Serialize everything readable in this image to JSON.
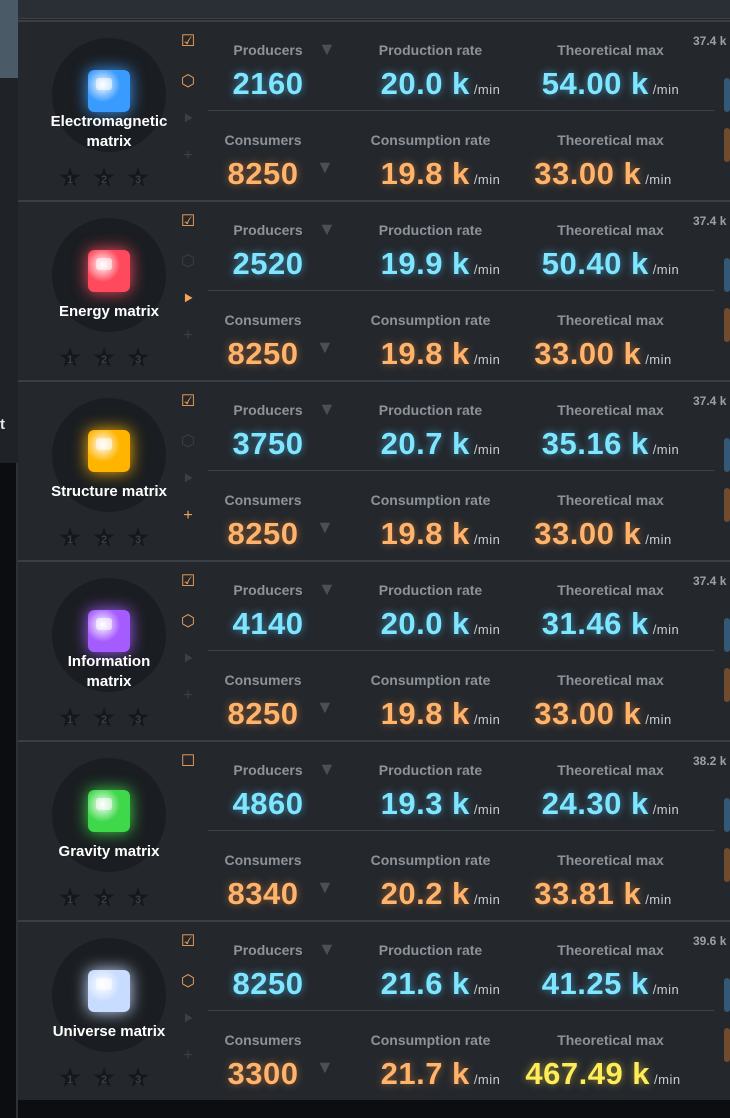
{
  "side_fragment": "t",
  "labels": {
    "producers": "Producers",
    "production_rate": "Production rate",
    "theoretical_max": "Theoretical max",
    "consumers": "Consumers",
    "consumption_rate": "Consumption rate",
    "per_min": "/min"
  },
  "matrices": [
    {
      "name": "Electromagnetic\nmatrix",
      "color": "#3a9bff",
      "producers": "2160",
      "production_rate": "20.0 k",
      "prod_max": "54.00 k",
      "consumers": "8250",
      "consumption_rate": "19.8 k",
      "cons_max": "33.00 k",
      "side_value": "37.4 k",
      "controls": {
        "check": "on",
        "box": "on",
        "play": "off",
        "plus": "off"
      }
    },
    {
      "name": "Energy matrix",
      "color": "#ff4a5e",
      "producers": "2520",
      "production_rate": "19.9 k",
      "prod_max": "50.40 k",
      "consumers": "8250",
      "consumption_rate": "19.8 k",
      "cons_max": "33.00 k",
      "side_value": "37.4 k",
      "controls": {
        "check": "on",
        "box": "off",
        "play": "on",
        "plus": "off"
      }
    },
    {
      "name": "Structure matrix",
      "color": "#ffb400",
      "producers": "3750",
      "production_rate": "20.7 k",
      "prod_max": "35.16 k",
      "consumers": "8250",
      "consumption_rate": "19.8 k",
      "cons_max": "33.00 k",
      "side_value": "37.4 k",
      "controls": {
        "check": "on",
        "box": "off",
        "play": "off",
        "plus": "on"
      }
    },
    {
      "name": "Information\nmatrix",
      "color": "#a55cff",
      "producers": "4140",
      "production_rate": "20.0 k",
      "prod_max": "31.46 k",
      "consumers": "8250",
      "consumption_rate": "19.8 k",
      "cons_max": "33.00 k",
      "side_value": "37.4 k",
      "controls": {
        "check": "on",
        "box": "on",
        "play": "off",
        "plus": "off"
      }
    },
    {
      "name": "Gravity matrix",
      "color": "#3fd84a",
      "producers": "4860",
      "production_rate": "19.3 k",
      "prod_max": "24.30 k",
      "consumers": "8340",
      "consumption_rate": "20.2 k",
      "cons_max": "33.81 k",
      "side_value": "38.2 k",
      "controls": {
        "check": "unchecked",
        "box": "none",
        "play": "none",
        "plus": "none"
      }
    },
    {
      "name": "Universe matrix",
      "color": "#c8dcff",
      "producers": "8250",
      "production_rate": "21.6 k",
      "prod_max": "41.25 k",
      "consumers": "3300",
      "consumption_rate": "21.7 k",
      "cons_max": "467.49 k",
      "side_value": "39.6 k",
      "controls": {
        "check": "on",
        "box": "on",
        "play": "off",
        "plus": "off"
      }
    }
  ],
  "colors": {
    "producer_value": "#7fe6ff",
    "consumer_value": "#ffb36b",
    "highlight_value": "#ffec5a",
    "control_active": "#f5a35a"
  },
  "icons": {
    "check": "checkbox-checked-icon",
    "unchecked": "checkbox-empty-icon",
    "box": "cube-outline-icon",
    "play": "play-forward-icon",
    "plus": "plus-icon",
    "filter": "funnel-filter-icon",
    "star": "star-rank-icon"
  }
}
